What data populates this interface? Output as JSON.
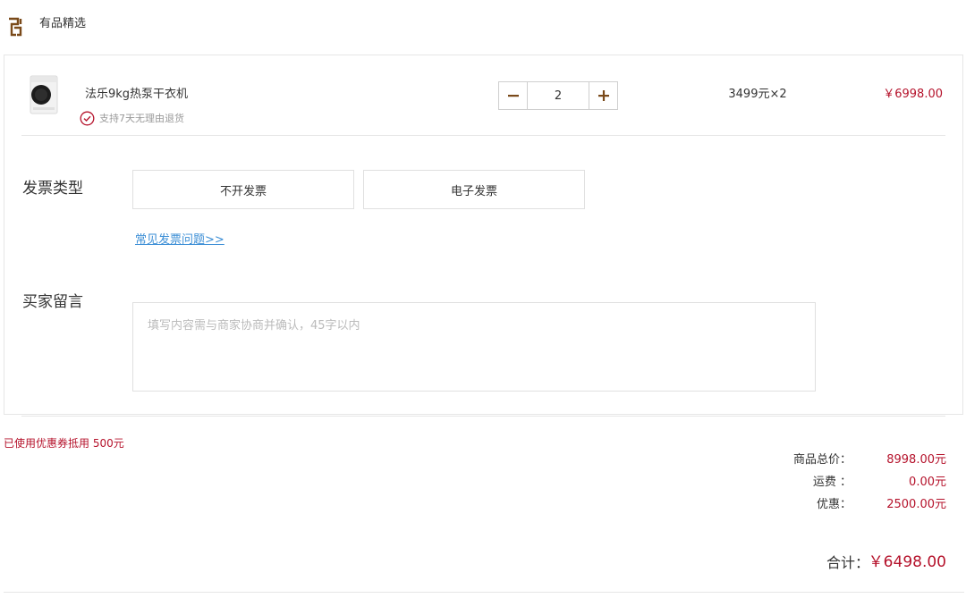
{
  "header": {
    "brand_name": "有品精选",
    "brand_icon": "youpin-logo-icon"
  },
  "product": {
    "name": "法乐9kg热泵干衣机",
    "image": "dryer-product-image",
    "return_policy": "支持7天无理由退货",
    "quantity": "2",
    "unit_price": "3499元×2",
    "line_total": "￥6998.00"
  },
  "invoice": {
    "label": "发票类型",
    "options": [
      "不开发票",
      "电子发票"
    ],
    "faq_link": "常见发票问题>>"
  },
  "message": {
    "label": "买家留言",
    "placeholder": "填写内容需与商家协商并确认，45字以内"
  },
  "coupon": {
    "text": "已使用优惠券抵用 500元"
  },
  "summary": {
    "rows": [
      {
        "label": "商品总价：",
        "value": "8998.00元"
      },
      {
        "label": "运费 ：",
        "value": "0.00元"
      },
      {
        "label": "优惠：",
        "value": "2500.00元"
      }
    ],
    "total_label": "合计：",
    "total_value": "￥6498.00"
  },
  "colors": {
    "accent_red": "#b5122b",
    "brand_brown": "#7a4a1a",
    "link_blue": "#3d8fd6"
  }
}
